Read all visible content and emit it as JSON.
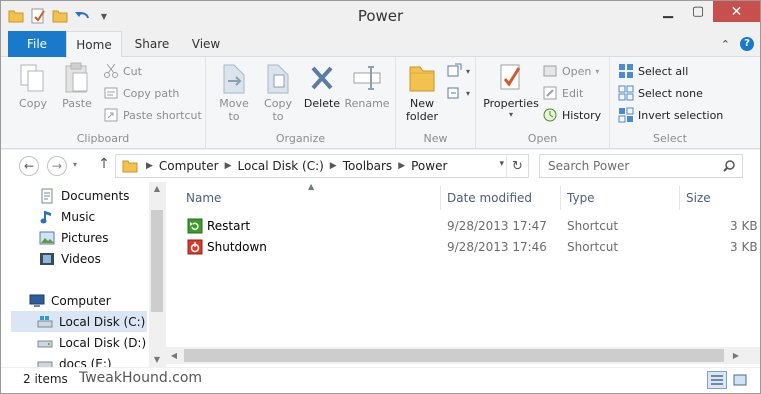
{
  "window": {
    "title": "Power"
  },
  "ribbon": {
    "tabs": {
      "file": "File",
      "home": "Home",
      "share": "Share",
      "view": "View"
    },
    "clipboard": {
      "label": "Clipboard",
      "copy": "Copy",
      "paste": "Paste",
      "cut": "Cut",
      "copy_path": "Copy path",
      "paste_shortcut": "Paste shortcut"
    },
    "organize": {
      "label": "Organize",
      "move_to_1": "Move",
      "move_to_2": "to",
      "copy_to_1": "Copy",
      "copy_to_2": "to",
      "delete": "Delete",
      "rename": "Rename"
    },
    "new": {
      "label": "New",
      "new_folder_1": "New",
      "new_folder_2": "folder"
    },
    "open": {
      "label": "Open",
      "properties": "Properties",
      "open": "Open",
      "edit": "Edit",
      "history": "History"
    },
    "select": {
      "label": "Select",
      "select_all": "Select all",
      "select_none": "Select none",
      "invert_selection": "Invert selection"
    }
  },
  "address": {
    "crumbs": [
      "Computer",
      "Local Disk (C:)",
      "Toolbars",
      "Power"
    ],
    "search_placeholder": "Search Power"
  },
  "nav_pane": {
    "items": [
      {
        "label": "Documents",
        "icon": "documents-icon"
      },
      {
        "label": "Music",
        "icon": "music-icon"
      },
      {
        "label": "Pictures",
        "icon": "pictures-icon"
      },
      {
        "label": "Videos",
        "icon": "videos-icon"
      },
      {
        "label": "Computer",
        "icon": "computer-icon"
      },
      {
        "label": "Local Disk (C:)",
        "icon": "drive-icon",
        "selected": true
      },
      {
        "label": "Local Disk (D:)",
        "icon": "drive-icon"
      },
      {
        "label": "docs (E:)",
        "icon": "drive-icon"
      }
    ]
  },
  "file_list": {
    "columns": {
      "name": "Name",
      "date": "Date modified",
      "type": "Type",
      "size": "Size"
    },
    "rows": [
      {
        "name": "Restart",
        "icon": "restart-icon",
        "date": "9/28/2013 17:47",
        "type": "Shortcut",
        "size": "3 KB"
      },
      {
        "name": "Shutdown",
        "icon": "shutdown-icon",
        "date": "9/28/2013 17:46",
        "type": "Shortcut",
        "size": "3 KB"
      }
    ]
  },
  "status": {
    "count": "2 items",
    "watermark": "TweakHound.com"
  },
  "colors": {
    "file_tab": "#1979ca",
    "close": "#c7504d",
    "selection": "#dbe6f4",
    "folder": "#f2c14e"
  }
}
